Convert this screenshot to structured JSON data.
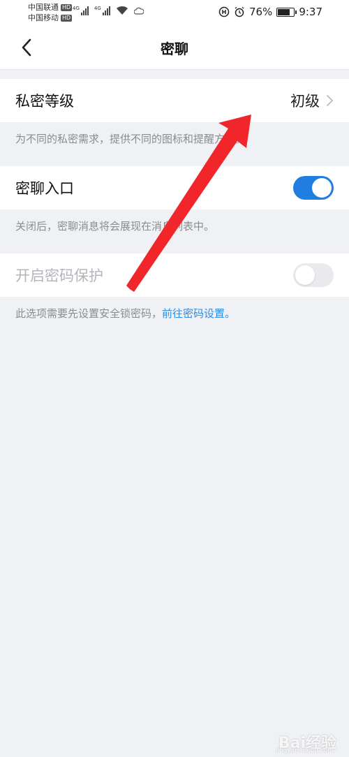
{
  "status_bar": {
    "carrier_1": "中国联通",
    "carrier_2": "中国移动",
    "hd_badge": "HD",
    "network_type": "4G",
    "battery_percent": "76%",
    "battery_level": 0.76,
    "time": "9:37"
  },
  "header": {
    "title": "密聊"
  },
  "settings": {
    "privacy_level": {
      "label": "私密等级",
      "value": "初级",
      "description": "为不同的私密需求，提供不同的图标和提醒方式。"
    },
    "secret_chat_entry": {
      "label": "密聊入口",
      "enabled": true,
      "description": "关闭后，密聊消息将会展现在消息列表中。"
    },
    "password_protection": {
      "label": "开启密码保护",
      "enabled": false,
      "description": "此选项需要先设置安全锁密码，",
      "link": "前往密码设置。"
    }
  },
  "colors": {
    "accent": "#1f7ee0",
    "link": "#2d8ce3",
    "annotation_arrow": "#f0262a",
    "background": "#f0f1f5"
  },
  "watermark": {
    "text": "Bai经验",
    "sub": "jingyan.baidu.com"
  }
}
